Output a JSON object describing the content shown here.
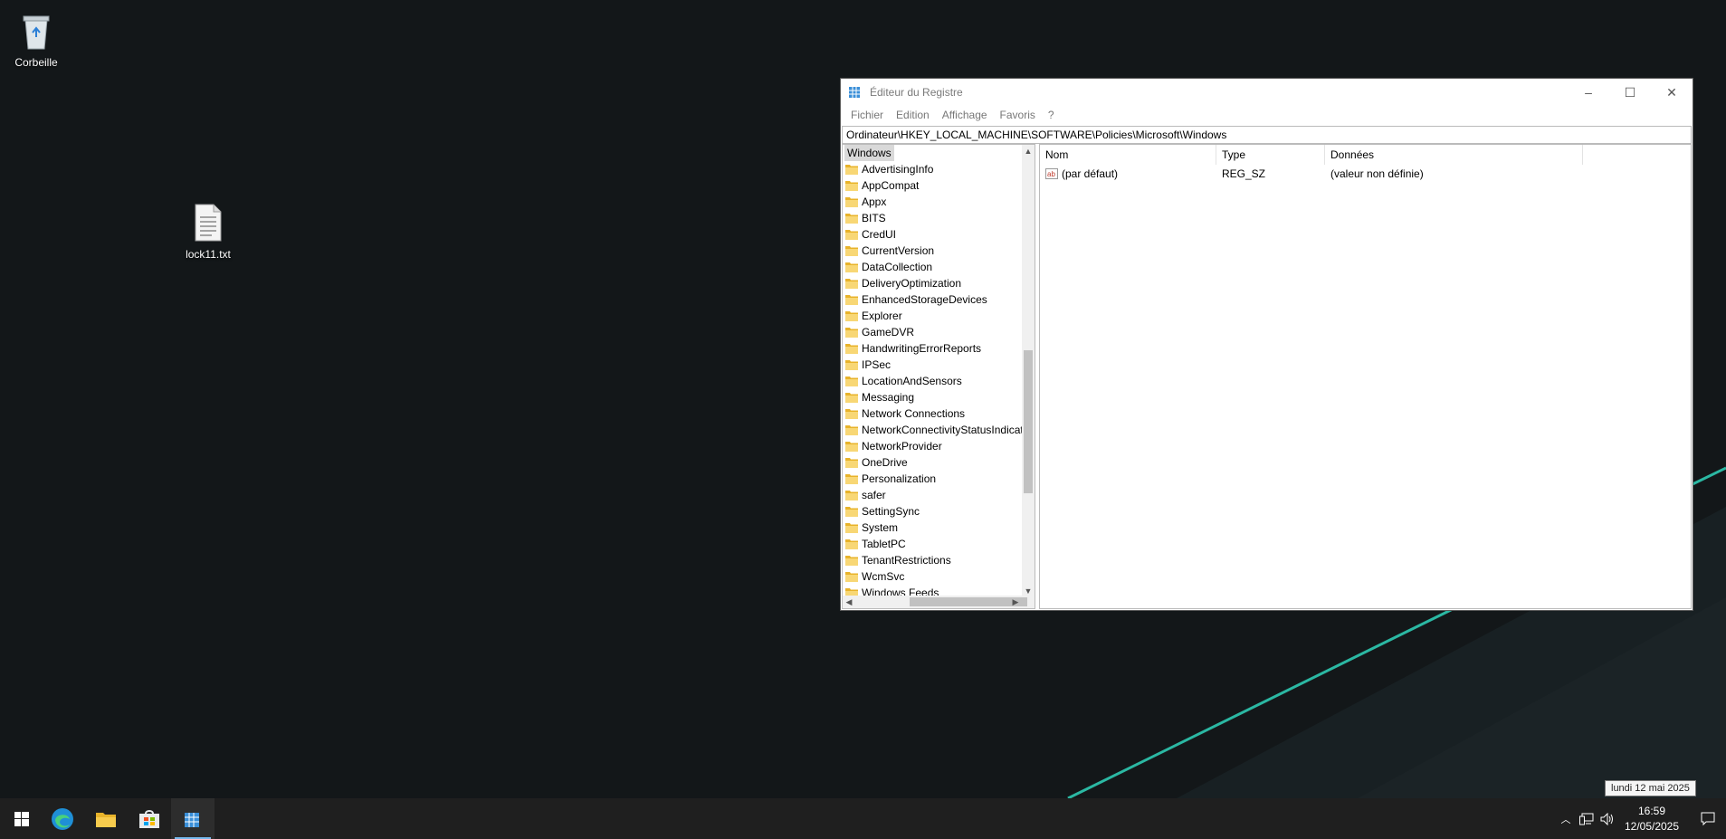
{
  "desktop": {
    "icons": [
      {
        "label": "Corbeille",
        "icon": "recycle-bin-icon"
      },
      {
        "label": "lock11.txt",
        "icon": "text-file-icon"
      }
    ]
  },
  "window": {
    "title": "Éditeur du Registre",
    "controls": {
      "minimize": "–",
      "maximize": "☐",
      "close": "✕"
    },
    "menu": [
      "Fichier",
      "Edition",
      "Affichage",
      "Favoris",
      "?"
    ],
    "address": "Ordinateur\\HKEY_LOCAL_MACHINE\\SOFTWARE\\Policies\\Microsoft\\Windows",
    "tree": {
      "root": "Windows",
      "items": [
        "AdvertisingInfo",
        "AppCompat",
        "Appx",
        "BITS",
        "CredUI",
        "CurrentVersion",
        "DataCollection",
        "DeliveryOptimization",
        "EnhancedStorageDevices",
        "Explorer",
        "GameDVR",
        "HandwritingErrorReports",
        "IPSec",
        "LocationAndSensors",
        "Messaging",
        "Network Connections",
        "NetworkConnectivityStatusIndicator",
        "NetworkProvider",
        "OneDrive",
        "Personalization",
        "safer",
        "SettingSync",
        "System",
        "TabletPC",
        "TenantRestrictions",
        "WcmSvc",
        "Windows Feeds"
      ]
    },
    "columns": {
      "name": "Nom",
      "type": "Type",
      "data": "Données"
    },
    "rows": [
      {
        "name": "(par défaut)",
        "type": "REG_SZ",
        "data": "(valeur non définie)"
      }
    ]
  },
  "taskbar": {
    "time": "16:59",
    "date": "12/05/2025",
    "tooltip": "lundi 12 mai 2025",
    "apps": [
      "start-icon",
      "edge-icon",
      "file-explorer-icon",
      "store-icon",
      "regedit-icon"
    ]
  },
  "colors": {
    "accent_line": "#2bb8a3",
    "taskbar": "#1f1f1f",
    "desktop": "#131719"
  }
}
